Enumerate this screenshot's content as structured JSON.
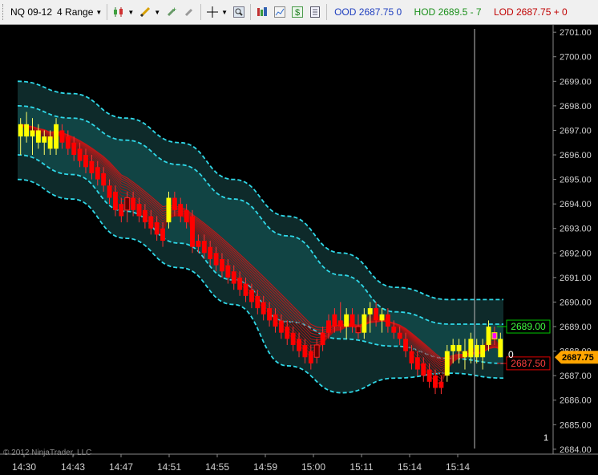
{
  "toolbar": {
    "instrument": "NQ 09-12",
    "period": "4 Range",
    "icons": [
      "candlestick-icon",
      "pencil-icon",
      "plus-cursor-icon",
      "brush-icon",
      "crosshair-icon",
      "zoom-icon",
      "data-box-icon",
      "chart-icon",
      "dollar-icon",
      "properties-icon"
    ],
    "ood_label": "OOD",
    "ood_value": "2687.75",
    "ood_change": "0",
    "hod_label": "HOD",
    "hod_value": "2689.5 - 7",
    "lod_label": "LOD",
    "lod_value": "2687.75 + 0"
  },
  "chart_data": {
    "type": "candlestick",
    "instrument": "NQ 09-12",
    "bar_type": "4 Range",
    "ylim": [
      2683.8,
      2701.3
    ],
    "yticks": [
      "2684.00",
      "2685.00",
      "2686.00",
      "2687.00",
      "2688.00",
      "2689.00",
      "2690.00",
      "2691.00",
      "2692.00",
      "2693.00",
      "2694.00",
      "2695.00",
      "2696.00",
      "2697.00",
      "2698.00",
      "2699.00",
      "2700.00",
      "2701.00"
    ],
    "xticks": [
      "14:30",
      "14:43",
      "14:47",
      "14:51",
      "14:55",
      "14:59",
      "15:00",
      "15:11",
      "15:14",
      "15:14"
    ],
    "bars": [
      {
        "o": 2696.75,
        "h": 2697.5,
        "l": 2696.0,
        "c": 2697.25,
        "color": "yellow"
      },
      {
        "o": 2697.25,
        "h": 2697.75,
        "l": 2696.5,
        "c": 2696.75,
        "color": "yellow"
      },
      {
        "o": 2696.75,
        "h": 2697.5,
        "l": 2696.0,
        "c": 2697.0,
        "color": "yellow"
      },
      {
        "o": 2697.0,
        "h": 2697.25,
        "l": 2696.25,
        "c": 2696.5,
        "color": "yellow"
      },
      {
        "o": 2696.5,
        "h": 2697.0,
        "l": 2696.0,
        "c": 2696.75,
        "color": "yellow"
      },
      {
        "o": 2696.75,
        "h": 2697.0,
        "l": 2696.0,
        "c": 2696.25,
        "color": "yellow"
      },
      {
        "o": 2696.25,
        "h": 2697.5,
        "l": 2696.0,
        "c": 2697.25,
        "color": "yellow"
      },
      {
        "o": 2697.0,
        "h": 2697.25,
        "l": 2696.25,
        "c": 2696.5,
        "color": "red"
      },
      {
        "o": 2696.75,
        "h": 2697.0,
        "l": 2696.0,
        "c": 2696.25,
        "color": "red"
      },
      {
        "o": 2696.5,
        "h": 2696.75,
        "l": 2695.75,
        "c": 2696.0,
        "color": "red"
      },
      {
        "o": 2696.25,
        "h": 2696.5,
        "l": 2695.5,
        "c": 2695.75,
        "color": "red"
      },
      {
        "o": 2696.0,
        "h": 2696.25,
        "l": 2695.25,
        "c": 2695.5,
        "color": "red"
      },
      {
        "o": 2695.75,
        "h": 2696.0,
        "l": 2695.0,
        "c": 2695.25,
        "color": "red"
      },
      {
        "o": 2695.5,
        "h": 2695.75,
        "l": 2694.75,
        "c": 2695.0,
        "color": "red"
      },
      {
        "o": 2695.25,
        "h": 2695.5,
        "l": 2694.5,
        "c": 2694.75,
        "color": "red"
      },
      {
        "o": 2694.75,
        "h": 2695.0,
        "l": 2694.0,
        "c": 2694.25,
        "color": "red"
      },
      {
        "o": 2694.5,
        "h": 2694.75,
        "l": 2693.5,
        "c": 2693.75,
        "color": "red"
      },
      {
        "o": 2694.0,
        "h": 2694.25,
        "l": 2693.25,
        "c": 2693.5,
        "color": "red"
      },
      {
        "o": 2693.75,
        "h": 2694.5,
        "l": 2693.25,
        "c": 2694.25,
        "color": "red_outline"
      },
      {
        "o": 2694.25,
        "h": 2694.5,
        "l": 2693.5,
        "c": 2693.75,
        "color": "red"
      },
      {
        "o": 2694.0,
        "h": 2694.25,
        "l": 2693.25,
        "c": 2693.5,
        "color": "red"
      },
      {
        "o": 2693.75,
        "h": 2694.0,
        "l": 2693.0,
        "c": 2693.25,
        "color": "red"
      },
      {
        "o": 2693.5,
        "h": 2693.75,
        "l": 2692.75,
        "c": 2693.0,
        "color": "red"
      },
      {
        "o": 2693.25,
        "h": 2693.5,
        "l": 2692.5,
        "c": 2692.75,
        "color": "red"
      },
      {
        "o": 2693.0,
        "h": 2693.25,
        "l": 2692.25,
        "c": 2692.5,
        "color": "red"
      },
      {
        "o": 2693.25,
        "h": 2694.5,
        "l": 2693.0,
        "c": 2694.25,
        "color": "yellow"
      },
      {
        "o": 2694.25,
        "h": 2694.5,
        "l": 2693.5,
        "c": 2693.75,
        "color": "red"
      },
      {
        "o": 2694.0,
        "h": 2694.25,
        "l": 2693.25,
        "c": 2693.5,
        "color": "red"
      },
      {
        "o": 2693.75,
        "h": 2694.0,
        "l": 2693.0,
        "c": 2693.25,
        "color": "red"
      },
      {
        "o": 2693.5,
        "h": 2693.75,
        "l": 2692.0,
        "c": 2692.25,
        "color": "red"
      },
      {
        "o": 2692.5,
        "h": 2692.75,
        "l": 2692.0,
        "c": 2692.25,
        "color": "red"
      },
      {
        "o": 2692.5,
        "h": 2692.75,
        "l": 2691.75,
        "c": 2692.0,
        "color": "red"
      },
      {
        "o": 2692.25,
        "h": 2692.5,
        "l": 2691.5,
        "c": 2691.75,
        "color": "red"
      },
      {
        "o": 2692.0,
        "h": 2692.25,
        "l": 2691.25,
        "c": 2691.5,
        "color": "red"
      },
      {
        "o": 2691.75,
        "h": 2692.0,
        "l": 2691.0,
        "c": 2691.25,
        "color": "red"
      },
      {
        "o": 2691.5,
        "h": 2691.75,
        "l": 2690.75,
        "c": 2691.0,
        "color": "red"
      },
      {
        "o": 2691.25,
        "h": 2691.5,
        "l": 2690.5,
        "c": 2690.75,
        "color": "red"
      },
      {
        "o": 2691.0,
        "h": 2691.25,
        "l": 2690.25,
        "c": 2690.5,
        "color": "red"
      },
      {
        "o": 2690.75,
        "h": 2691.0,
        "l": 2690.0,
        "c": 2690.25,
        "color": "red"
      },
      {
        "o": 2690.5,
        "h": 2690.75,
        "l": 2689.75,
        "c": 2690.0,
        "color": "red"
      },
      {
        "o": 2690.25,
        "h": 2690.5,
        "l": 2689.5,
        "c": 2689.75,
        "color": "red"
      },
      {
        "o": 2690.0,
        "h": 2690.25,
        "l": 2689.25,
        "c": 2689.5,
        "color": "red"
      },
      {
        "o": 2689.75,
        "h": 2690.0,
        "l": 2689.0,
        "c": 2689.25,
        "color": "red"
      },
      {
        "o": 2689.5,
        "h": 2689.75,
        "l": 2688.75,
        "c": 2689.0,
        "color": "red"
      },
      {
        "o": 2689.25,
        "h": 2689.5,
        "l": 2688.5,
        "c": 2688.75,
        "color": "red"
      },
      {
        "o": 2689.0,
        "h": 2689.25,
        "l": 2688.25,
        "c": 2688.5,
        "color": "red"
      },
      {
        "o": 2688.75,
        "h": 2689.0,
        "l": 2688.0,
        "c": 2688.25,
        "color": "red"
      },
      {
        "o": 2688.5,
        "h": 2688.75,
        "l": 2687.75,
        "c": 2688.0,
        "color": "red"
      },
      {
        "o": 2688.25,
        "h": 2688.5,
        "l": 2687.5,
        "c": 2687.75,
        "color": "red"
      },
      {
        "o": 2688.0,
        "h": 2688.25,
        "l": 2687.25,
        "c": 2687.5,
        "color": "red"
      },
      {
        "o": 2687.75,
        "h": 2688.5,
        "l": 2687.5,
        "c": 2688.25,
        "color": "red_outline"
      },
      {
        "o": 2688.25,
        "h": 2689.0,
        "l": 2688.0,
        "c": 2688.75,
        "color": "red"
      },
      {
        "o": 2688.75,
        "h": 2689.5,
        "l": 2688.5,
        "c": 2689.25,
        "color": "red"
      },
      {
        "o": 2689.0,
        "h": 2689.75,
        "l": 2688.75,
        "c": 2689.5,
        "color": "red"
      },
      {
        "o": 2689.25,
        "h": 2690.0,
        "l": 2688.75,
        "c": 2689.0,
        "color": "red"
      },
      {
        "o": 2689.0,
        "h": 2689.75,
        "l": 2688.5,
        "c": 2689.5,
        "color": "yellow"
      },
      {
        "o": 2689.5,
        "h": 2689.75,
        "l": 2688.75,
        "c": 2689.0,
        "color": "red"
      },
      {
        "o": 2689.0,
        "h": 2689.5,
        "l": 2688.5,
        "c": 2688.75,
        "color": "red_outline"
      },
      {
        "o": 2688.75,
        "h": 2689.75,
        "l": 2688.5,
        "c": 2689.5,
        "color": "yellow"
      },
      {
        "o": 2689.5,
        "h": 2690.0,
        "l": 2688.75,
        "c": 2689.75,
        "color": "yellow"
      },
      {
        "o": 2689.75,
        "h": 2690.0,
        "l": 2689.0,
        "c": 2689.25,
        "color": "red"
      },
      {
        "o": 2689.25,
        "h": 2689.75,
        "l": 2688.75,
        "c": 2689.5,
        "color": "yellow"
      },
      {
        "o": 2689.5,
        "h": 2689.75,
        "l": 2688.75,
        "c": 2689.0,
        "color": "red"
      },
      {
        "o": 2689.0,
        "h": 2689.25,
        "l": 2688.5,
        "c": 2688.75,
        "color": "red"
      },
      {
        "o": 2688.75,
        "h": 2689.0,
        "l": 2688.25,
        "c": 2688.5,
        "color": "red"
      },
      {
        "o": 2688.5,
        "h": 2688.75,
        "l": 2687.75,
        "c": 2688.0,
        "color": "red"
      },
      {
        "o": 2688.0,
        "h": 2688.25,
        "l": 2687.25,
        "c": 2687.5,
        "color": "red"
      },
      {
        "o": 2687.75,
        "h": 2688.0,
        "l": 2687.0,
        "c": 2687.25,
        "color": "red"
      },
      {
        "o": 2687.5,
        "h": 2687.75,
        "l": 2686.75,
        "c": 2687.0,
        "color": "red"
      },
      {
        "o": 2687.25,
        "h": 2687.5,
        "l": 2686.5,
        "c": 2686.75,
        "color": "red"
      },
      {
        "o": 2687.0,
        "h": 2687.25,
        "l": 2686.25,
        "c": 2686.5,
        "color": "red"
      },
      {
        "o": 2686.75,
        "h": 2687.0,
        "l": 2686.25,
        "c": 2686.5,
        "color": "red"
      },
      {
        "o": 2687.0,
        "h": 2688.25,
        "l": 2686.75,
        "c": 2688.0,
        "color": "yellow"
      },
      {
        "o": 2688.0,
        "h": 2688.5,
        "l": 2687.5,
        "c": 2688.25,
        "color": "yellow"
      },
      {
        "o": 2688.0,
        "h": 2688.5,
        "l": 2687.5,
        "c": 2688.25,
        "color": "yellow"
      },
      {
        "o": 2688.0,
        "h": 2688.5,
        "l": 2687.25,
        "c": 2687.75,
        "color": "yellow"
      },
      {
        "o": 2687.75,
        "h": 2688.75,
        "l": 2687.5,
        "c": 2688.5,
        "color": "yellow"
      },
      {
        "o": 2688.25,
        "h": 2688.5,
        "l": 2687.5,
        "c": 2687.75,
        "color": "yellow"
      },
      {
        "o": 2687.75,
        "h": 2688.5,
        "l": 2687.25,
        "c": 2688.25,
        "color": "yellow"
      },
      {
        "o": 2688.25,
        "h": 2689.25,
        "l": 2688.0,
        "c": 2689.0,
        "color": "yellow"
      },
      {
        "o": 2688.75,
        "h": 2689.0,
        "l": 2688.25,
        "c": 2688.5,
        "color": "magenta"
      },
      {
        "o": 2688.5,
        "h": 2688.75,
        "l": 2687.75,
        "c": 2687.75,
        "color": "yellow"
      }
    ],
    "bands": {
      "outer_upper": [
        2699.0,
        2698.5,
        2697.5,
        2696.5,
        2695.0,
        2693.5,
        2692.0,
        2690.6,
        2690.1,
        2690.1
      ],
      "inner_upper": [
        2698.0,
        2697.5,
        2696.6,
        2695.6,
        2694.2,
        2692.7,
        2691.1,
        2689.6,
        2689.1,
        2689.1
      ],
      "inner_lower": [
        2696.0,
        2695.2,
        2693.7,
        2692.4,
        2690.9,
        2689.2,
        2688.5,
        2688.2,
        2687.7,
        2687.5
      ],
      "outer_lower": [
        2695.0,
        2694.2,
        2692.6,
        2691.4,
        2689.9,
        2687.4,
        2686.3,
        2686.9,
        2687.1,
        2686.9
      ]
    },
    "price_markers": [
      {
        "label": "2689.00",
        "value": 2689.0,
        "color": "#00c800"
      },
      {
        "label": "2687.50",
        "value": 2687.5,
        "color": "#e00000"
      },
      {
        "label": "2687.75",
        "value": 2687.75,
        "color": "#ffa500"
      }
    ],
    "last_price_label": "2687.75",
    "volume_marker": "0",
    "pane_number": "1",
    "copyright": "© 2012 NinjaTrader, LLC"
  }
}
